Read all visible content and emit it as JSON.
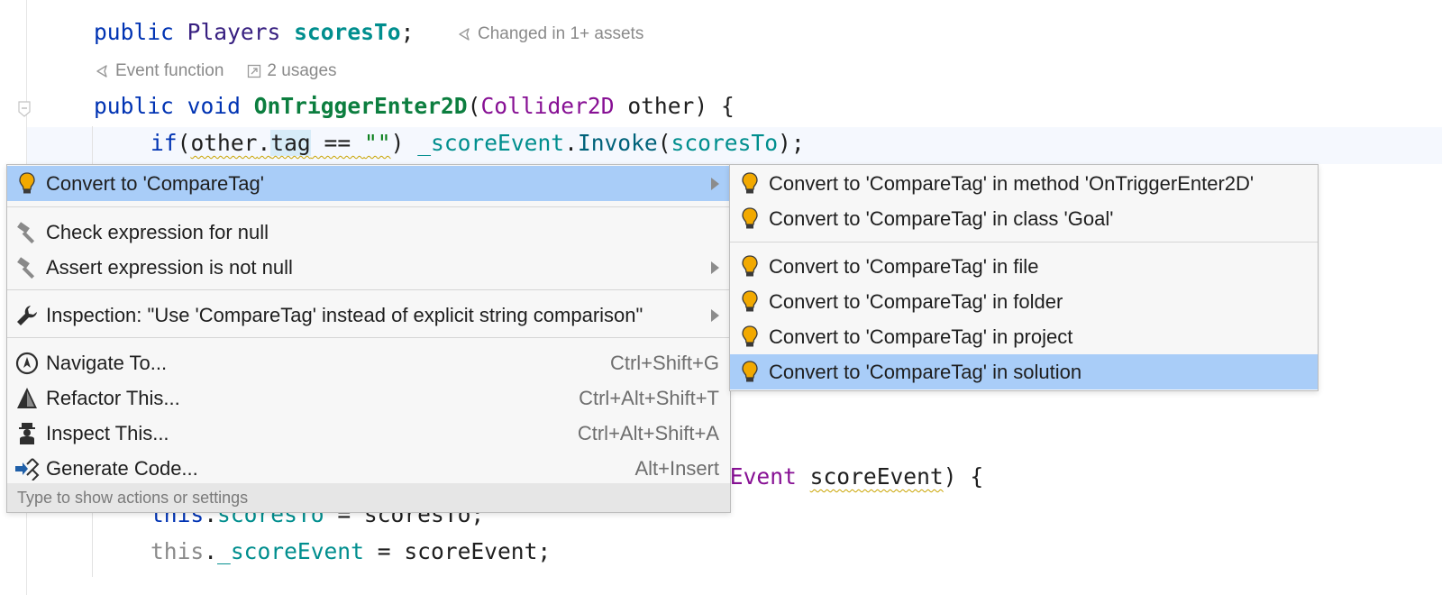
{
  "editor": {
    "line1": {
      "kw": "public",
      "type": "Players",
      "field": "scoresTo",
      "semi": ";"
    },
    "hint1": {
      "text": "Changed in 1+ assets"
    },
    "hint2": {
      "event": "Event function",
      "usages": "2 usages"
    },
    "line2": {
      "kw1": "public",
      "kw2": "void",
      "method": "OnTriggerEnter2D",
      "open": "(",
      "ptype": "Collider2D",
      "pname": " other) {"
    },
    "line3": {
      "kw": "if",
      "p1": "(",
      "other": "other",
      "dot": ".",
      "tag": "tag",
      "eq": " == ",
      "str": "\"\"",
      "p2": ") ",
      "fld": "_scoreEvent",
      "dot2": ".",
      "invoke": "Invoke",
      "p3": "(",
      "arg": "scoresTo",
      "end": ");"
    },
    "line4": {
      "type": "eEvent",
      "param": "scoreEvent",
      "end": ") {"
    },
    "line5": {
      "this": "this",
      "dot": ".",
      "field": "scoresTo",
      "rest": " = scoresTo;"
    },
    "line6": {
      "this": "this",
      "dot": ".",
      "field": "_scoreEvent",
      "rest": " = scoreEvent;"
    }
  },
  "menu": {
    "items": [
      {
        "label": "Convert to 'CompareTag'",
        "icon": "lightbulb-icon",
        "submenu": true,
        "selected": true
      },
      {
        "label": "Check expression for null",
        "icon": "hammer-icon"
      },
      {
        "label": "Assert expression is not null",
        "icon": "hammer-icon",
        "submenu": true
      },
      {
        "label": "Inspection: \"Use 'CompareTag' instead of explicit string comparison\"",
        "icon": "wrench-icon",
        "submenu": true
      },
      {
        "label": "Navigate To...",
        "icon": "navigate-icon",
        "shortcut": "Ctrl+Shift+G"
      },
      {
        "label": "Refactor This...",
        "icon": "refactor-icon",
        "shortcut": "Ctrl+Alt+Shift+T"
      },
      {
        "label": "Inspect This...",
        "icon": "inspect-icon",
        "shortcut": "Ctrl+Alt+Shift+A"
      },
      {
        "label": "Generate Code...",
        "icon": "generate-icon",
        "shortcut": "Alt+Insert"
      }
    ],
    "footer": "Type to show actions or settings"
  },
  "submenu": {
    "items": [
      {
        "label": "Convert to 'CompareTag' in method 'OnTriggerEnter2D'"
      },
      {
        "label": "Convert to 'CompareTag' in class 'Goal'"
      },
      {
        "label": "Convert to 'CompareTag' in file"
      },
      {
        "label": "Convert to 'CompareTag' in folder"
      },
      {
        "label": "Convert to 'CompareTag' in project"
      },
      {
        "label": "Convert to 'CompareTag' in solution",
        "selected": true
      }
    ]
  },
  "colors": {
    "selection": "#a9cdf8",
    "keyword": "#0033b3",
    "field": "#008e8e",
    "bulb": "#f2a900"
  }
}
